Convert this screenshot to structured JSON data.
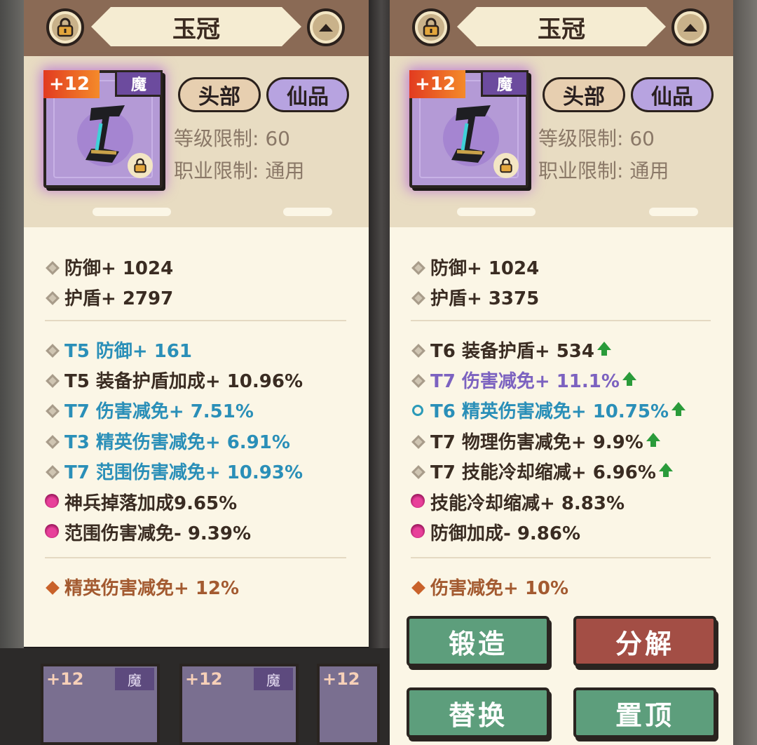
{
  "left_panel": {
    "title": "玉冠",
    "plus_level": "+12",
    "mo_label": "魔",
    "tag_slot": "头部",
    "tag_grade": "仙品",
    "level_req": "等级限制: 60",
    "class_req": "职业限制: 通用",
    "base_stats": [
      "防御+ 1024",
      "护盾+ 2797"
    ],
    "affixes": [
      {
        "text": "T5 防御+ 161",
        "color": "blue"
      },
      {
        "text": "T5 装备护盾加成+ 10.96%",
        "color": "dark"
      },
      {
        "text": "T7 伤害减免+ 7.51%",
        "color": "blue"
      },
      {
        "text": "T3 精英伤害减免+ 6.91%",
        "color": "blue"
      },
      {
        "text": "T7 范围伤害减免+ 10.93%",
        "color": "blue"
      }
    ],
    "special": [
      "神兵掉落加成9.65%",
      "范围伤害减免- 9.39%"
    ],
    "set_bonus": "精英伤害减免+ 12%"
  },
  "right_panel": {
    "title": "玉冠",
    "plus_level": "+12",
    "mo_label": "魔",
    "tag_slot": "头部",
    "tag_grade": "仙品",
    "level_req": "等级限制: 60",
    "class_req": "职业限制: 通用",
    "base_stats": [
      "防御+ 1024",
      "护盾+ 3375"
    ],
    "affixes": [
      {
        "text": "T6 装备护盾+ 534",
        "color": "dark",
        "up": true,
        "marker": "diamond"
      },
      {
        "text": "T7 伤害减免+ 11.1%",
        "color": "purple",
        "up": true,
        "marker": "diamond"
      },
      {
        "text": "T6 精英伤害减免+ 10.75%",
        "color": "blue",
        "up": true,
        "marker": "ring"
      },
      {
        "text": "T7 物理伤害减免+ 9.9%",
        "color": "dark",
        "up": true,
        "marker": "diamond"
      },
      {
        "text": "T7 技能冷却缩减+ 6.96%",
        "color": "dark",
        "up": true,
        "marker": "diamond"
      }
    ],
    "special": [
      "技能冷却缩减+ 8.83%",
      "防御加成- 9.86%"
    ],
    "set_bonus": "伤害减免+ 10%",
    "buttons": {
      "forge": "锻造",
      "decompose": "分解",
      "replace": "替换",
      "pin": "置顶"
    }
  },
  "thumbnails": [
    {
      "plus": "+12",
      "mo": "魔"
    },
    {
      "plus": "+12",
      "mo": "魔"
    },
    {
      "plus": "+12",
      "mo": ""
    }
  ]
}
